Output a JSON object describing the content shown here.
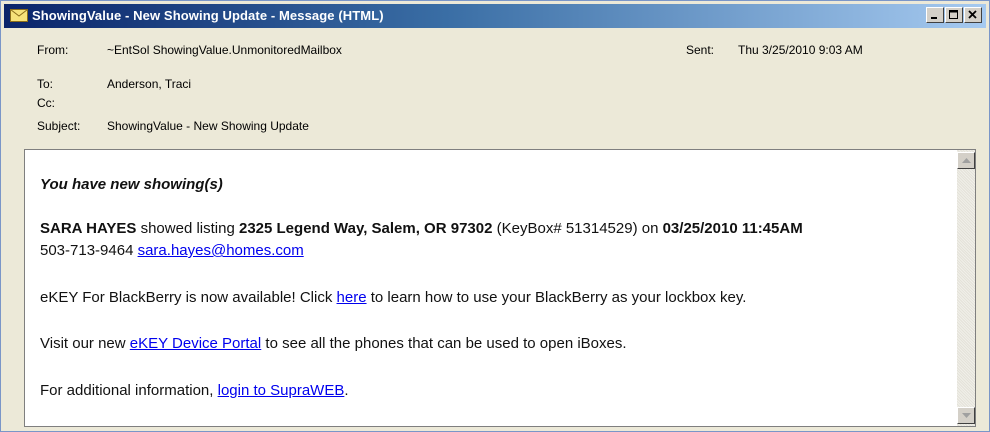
{
  "window": {
    "title": "ShowingValue - New Showing Update - Message (HTML)",
    "title_icon": "envelope-icon",
    "controls": {
      "minimize": "minimize-icon",
      "restore": "restore-icon",
      "close": "close-icon"
    }
  },
  "header": {
    "from_label": "From:",
    "from_value": "~EntSol ShowingValue.UnmonitoredMailbox",
    "sent_label": "Sent:",
    "sent_value": "Thu 3/25/2010 9:03 AM",
    "to_label": "To:",
    "to_value": "Anderson, Traci",
    "cc_label": "Cc:",
    "cc_value": "",
    "subject_label": "Subject:",
    "subject_value": "ShowingValue - New Showing Update"
  },
  "body": {
    "heading": "You have new showing(s)",
    "agent_name": "SARA HAYES",
    "showed_listing_text": "showed listing",
    "listing_address": "2325 Legend Way, Salem, OR 97302",
    "keybox_text": "(KeyBox# 51314529) on",
    "showing_datetime": "03/25/2010 11:45AM",
    "agent_phone": "503-713-9464",
    "agent_email": "sara.hayes@homes.com",
    "ekey_text_before": "eKEY For BlackBerry is now available! Click",
    "ekey_link": "here",
    "ekey_text_after": "to learn how to use your BlackBerry as your lockbox key.",
    "portal_text_before": "Visit our new",
    "portal_link": "eKEY Device Portal",
    "portal_text_after": "to see all the phones that can be used to open iBoxes.",
    "info_text_before": "For additional information,",
    "info_link": "login to SupraWEB",
    "info_text_after": "."
  },
  "colors": {
    "link": "#0000ee",
    "titlebar_start": "#0a246a",
    "titlebar_end": "#a6caf0",
    "window_bg": "#ece9d8"
  }
}
